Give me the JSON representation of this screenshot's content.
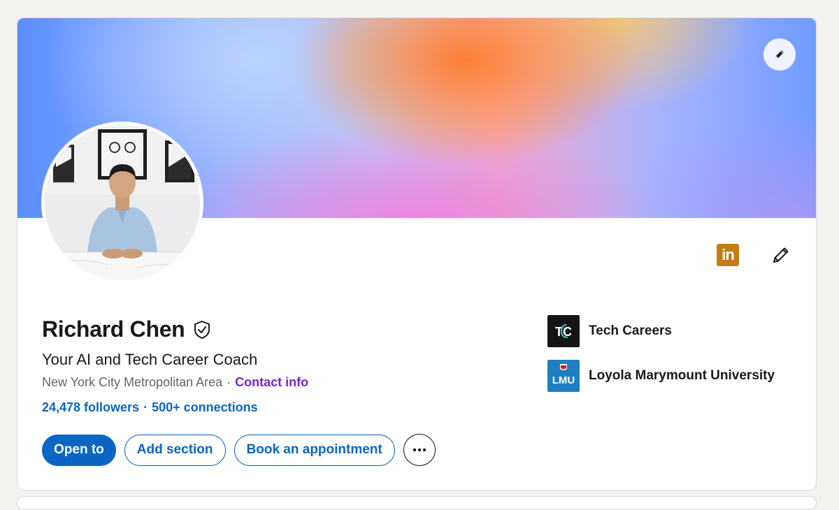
{
  "profile": {
    "name": "Richard Chen",
    "headline": "Your AI and Tech Career Coach",
    "location": "New York City Metropolitan Area",
    "location_separator": "·",
    "contact_label": "Contact info",
    "followers": "24,478 followers",
    "stats_separator": "·",
    "connections": "500+ connections"
  },
  "actions": {
    "open_to": "Open to",
    "add_section": "Add section",
    "book_appointment": "Book an appointment"
  },
  "top_icons": {
    "linkedin_badge": "in"
  },
  "affiliations": [
    {
      "label": "Tech Careers",
      "logo_text": "TC",
      "logo_bg": "#1a1a1a"
    },
    {
      "label": "Loyola Marymount University",
      "logo_text": "LMU",
      "logo_bg": "#1e7fc0"
    }
  ],
  "colors": {
    "primary": "#0a66c2",
    "contact_link": "#7a25c9",
    "linkedin_badge": "#c37d16"
  }
}
